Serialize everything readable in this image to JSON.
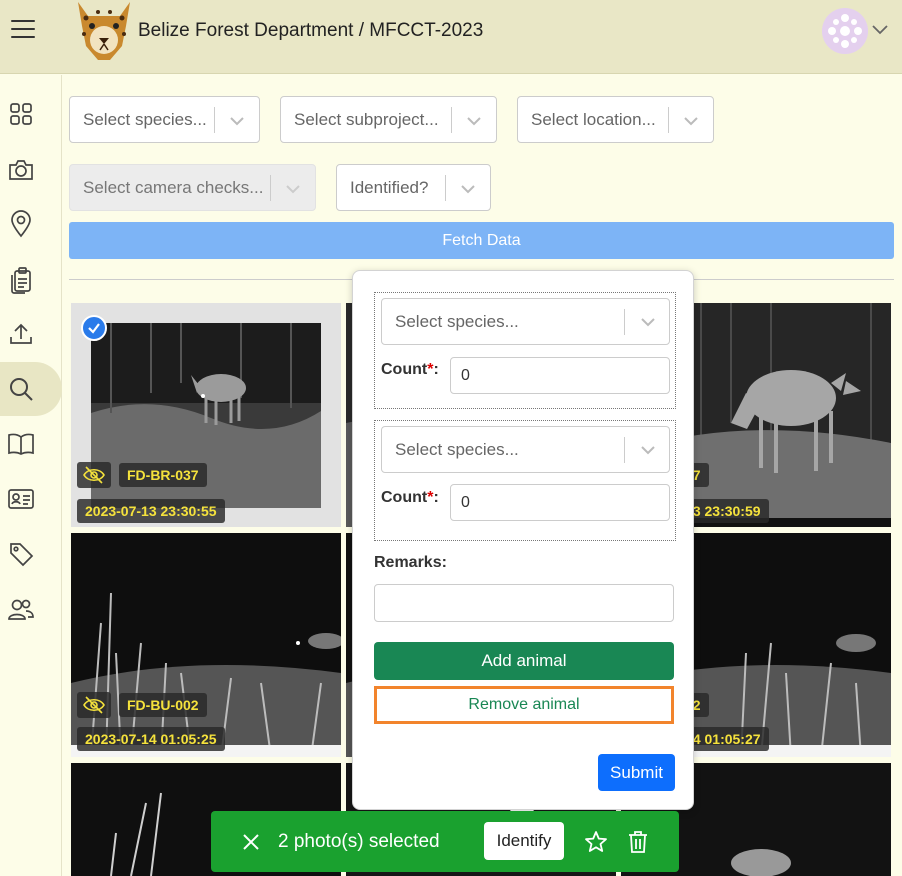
{
  "header": {
    "title": "Belize Forest Department / MFCCT-2023",
    "menu_icon": "hamburger-menu-icon",
    "logo": "jaguar-logo",
    "avatar_icon": "user-avatar",
    "account_menu_icon": "chevron-down-icon"
  },
  "sidebar": {
    "active": "search",
    "items": [
      {
        "name": "dashboard",
        "icon": "grid-icon"
      },
      {
        "name": "camera",
        "icon": "camera-icon"
      },
      {
        "name": "locations",
        "icon": "location-pin-icon"
      },
      {
        "name": "clipboard",
        "icon": "clipboard-icon"
      },
      {
        "name": "upload",
        "icon": "upload-icon"
      },
      {
        "name": "search",
        "icon": "search-icon"
      },
      {
        "name": "guide",
        "icon": "book-icon"
      },
      {
        "name": "id-card",
        "icon": "id-card-icon"
      },
      {
        "name": "tags",
        "icon": "tag-icon"
      },
      {
        "name": "users",
        "icon": "users-icon"
      }
    ]
  },
  "filters": {
    "species_placeholder": "Select species...",
    "subproject_placeholder": "Select subproject...",
    "location_placeholder": "Select location...",
    "camera_checks_placeholder": "Select camera checks...",
    "identified_placeholder": "Identified?",
    "fetch_label": "Fetch Data"
  },
  "photos": [
    {
      "station": "FD-BR-037",
      "timestamp": "2023-07-13 23:30:55",
      "selected": true,
      "hidden_icon": "eye-slash-icon"
    },
    {
      "station": "FD-BR-037",
      "timestamp": "2023-07-13 23:30:59",
      "selected": false
    },
    {
      "station": "FD-BU-002",
      "timestamp": "2023-07-14 01:05:25",
      "selected": false,
      "hidden_icon": "eye-slash-icon"
    },
    {
      "station": "FD-BU-002",
      "timestamp": "2023-07-14 01:05:27",
      "selected": false
    }
  ],
  "identify_popover": {
    "animals": [
      {
        "species_placeholder": "Select species...",
        "count_label": "Count",
        "required_mark": "*",
        "count_suffix": ":",
        "count_value": "0"
      },
      {
        "species_placeholder": "Select species...",
        "count_label": "Count",
        "required_mark": "*",
        "count_suffix": ":",
        "count_value": "0"
      }
    ],
    "remarks_label": "Remarks:",
    "remarks_value": "",
    "add_animal_label": "Add animal",
    "remove_animal_label": "Remove animal",
    "submit_label": "Submit"
  },
  "selection_bar": {
    "selected_text": "2 photo(s) selected",
    "identify_label": "Identify",
    "close_icon": "close-icon",
    "favorite_icon": "star-icon",
    "delete_icon": "trash-icon"
  },
  "colors": {
    "header_bg": "#e9e7c6",
    "page_bg": "#fdfde8",
    "fetch_button": "#7db4f6",
    "add_animal": "#198754",
    "submit": "#0d6efd",
    "selection_bar": "#1aa12f",
    "remove_highlight": "#f2842c",
    "tag_text": "#f5e23c"
  }
}
